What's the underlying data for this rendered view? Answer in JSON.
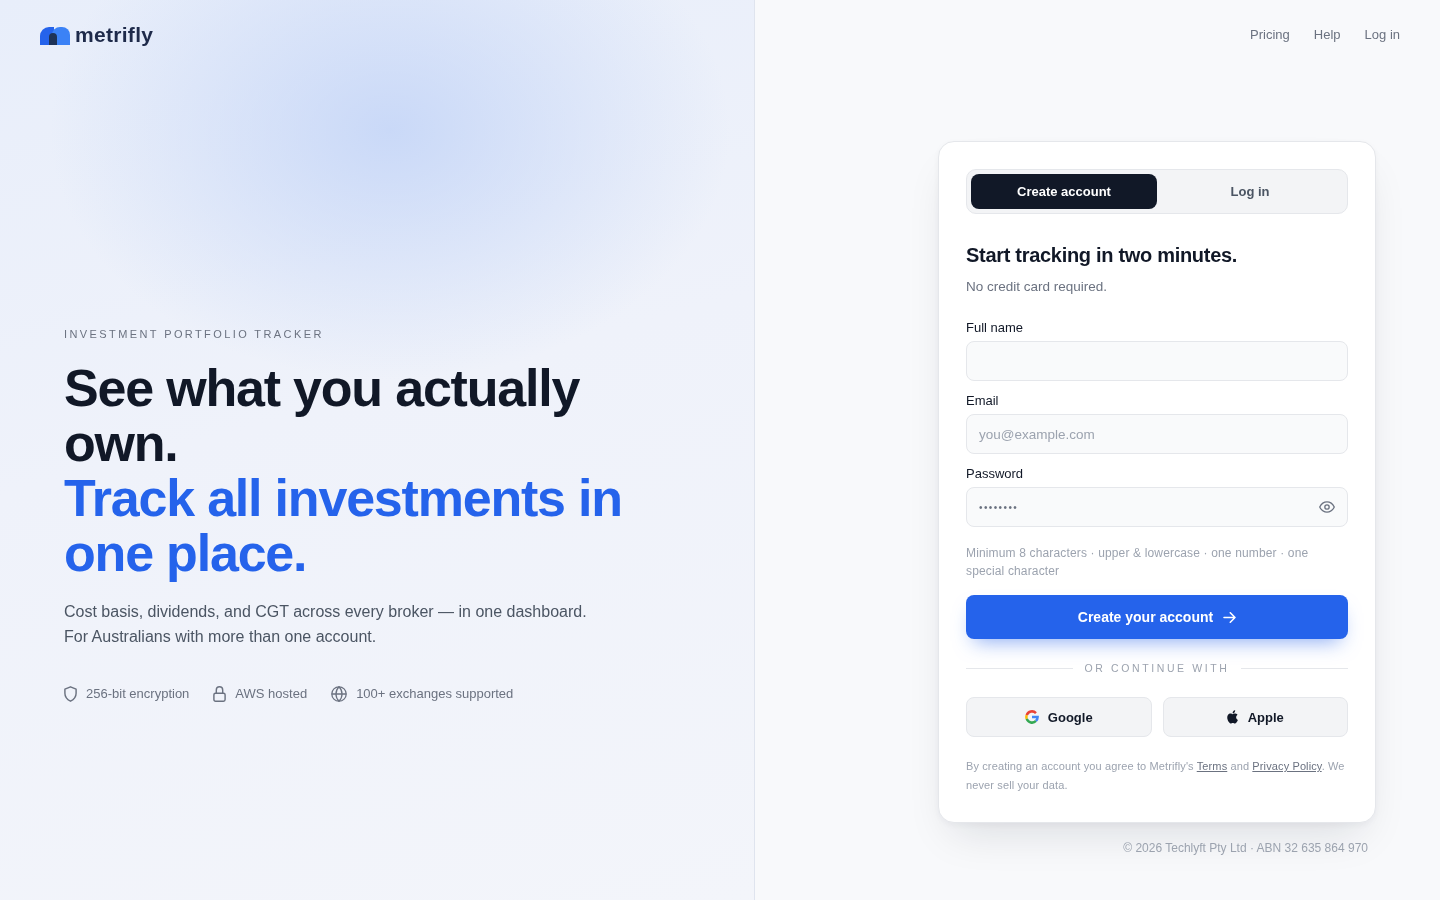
{
  "brand": {
    "name": "metrifly"
  },
  "nav_links": [
    "Pricing",
    "Help",
    "Log in"
  ],
  "hero": {
    "eyebrow": "INVESTMENT PORTFOLIO TRACKER",
    "headline": "See what you actually own.",
    "headline_accent": "Track all investments in one place.",
    "description": [
      "Cost basis, dividends, and CGT across every broker — in one dashboard.",
      "For Australians with more than one account."
    ],
    "trust_items": [
      "256-bit encryption",
      "AWS hosted",
      "100+ exchanges supported"
    ]
  },
  "signup_card": {
    "tabs": [
      {
        "label": "Create account",
        "selected": true
      },
      {
        "label": "Log in",
        "selected": false
      }
    ],
    "title": "Start tracking in two minutes.",
    "subtitle": "No credit card required.",
    "fields": [
      {
        "kind": "text",
        "label": "Full name"
      },
      {
        "kind": "email",
        "label": "Email",
        "placeholder": "you@example.com"
      },
      {
        "kind": "password",
        "label": "Password",
        "value": "••••••••"
      }
    ],
    "password_hint": "Minimum 8 characters · upper & lowercase · one number · one special character",
    "submit_button": "Create your account",
    "divider": "OR CONTINUE WITH",
    "social_buttons": [
      "Google",
      "Apple"
    ],
    "legal": [
      {
        "kind": "text",
        "text": "By creating an account you agree to Metrifly's "
      },
      {
        "kind": "link",
        "text": "Terms"
      },
      {
        "kind": "text",
        "text": " and "
      },
      {
        "kind": "link",
        "text": "Privacy Policy"
      },
      {
        "kind": "text",
        "text": ". We never sell your data."
      }
    ]
  },
  "footer": "© 2026 Techlyft Pty Ltd · ABN 32 635 864 970"
}
